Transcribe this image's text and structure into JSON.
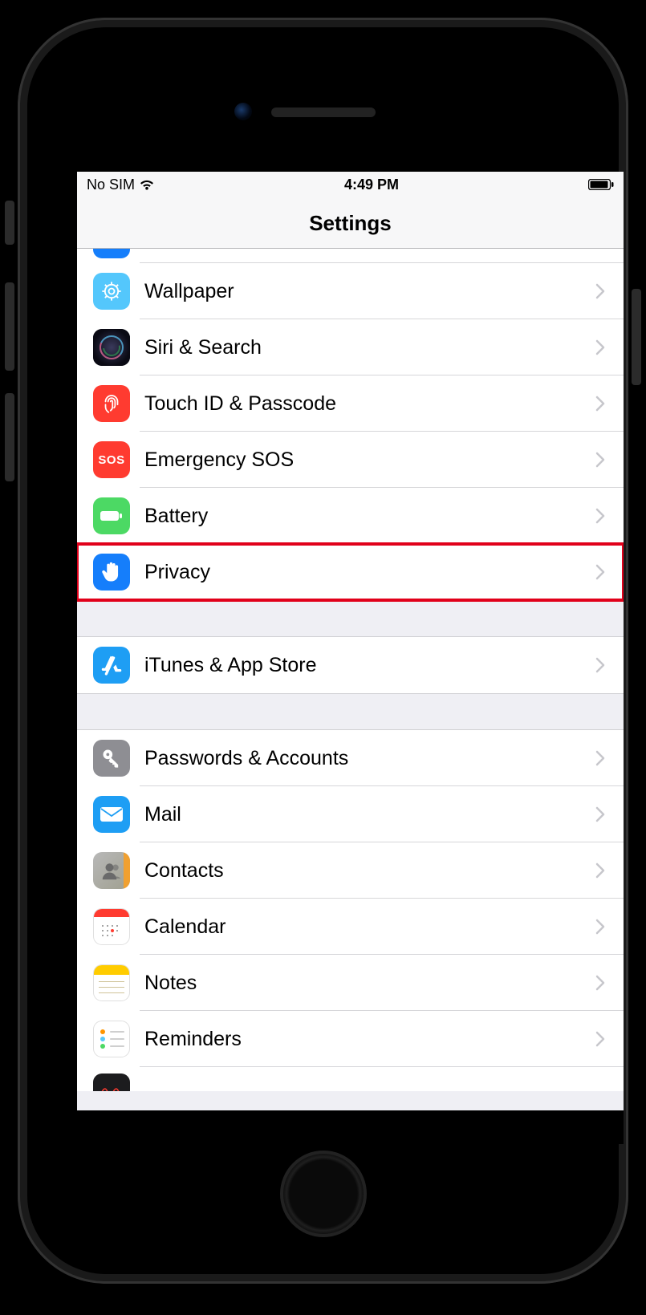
{
  "status": {
    "carrier": "No SIM",
    "time": "4:49 PM"
  },
  "header": {
    "title": "Settings"
  },
  "rows": {
    "wallpaper": "Wallpaper",
    "siri": "Siri & Search",
    "touchid": "Touch ID & Passcode",
    "sos": "Emergency SOS",
    "sos_icon_text": "SOS",
    "battery": "Battery",
    "privacy": "Privacy",
    "appstore": "iTunes & App Store",
    "passwords": "Passwords & Accounts",
    "mail": "Mail",
    "contacts": "Contacts",
    "calendar": "Calendar",
    "notes": "Notes",
    "reminders": "Reminders"
  },
  "highlighted_row": "privacy"
}
